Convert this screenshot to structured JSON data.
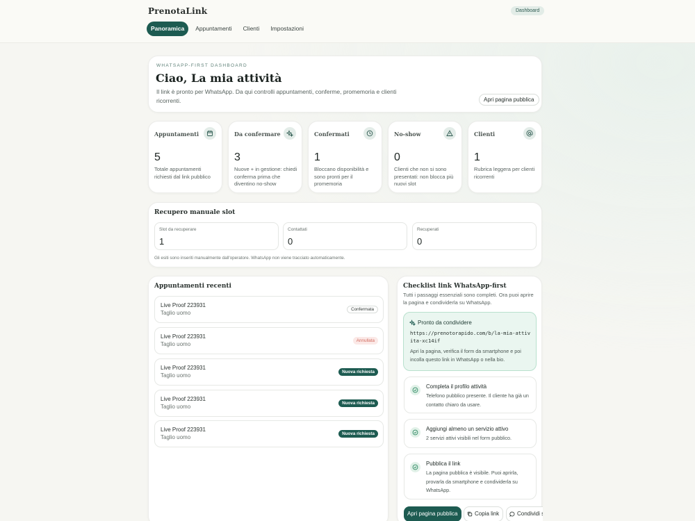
{
  "header": {
    "brand": "PrenotaLink",
    "badge": "Dashboard",
    "nav": [
      "Panoramica",
      "Appuntamenti",
      "Clienti",
      "Impostazioni"
    ]
  },
  "hero": {
    "eyebrow": "WHATSAPP-FIRST DASHBOARD",
    "title": "Ciao, La mia attività",
    "description": "Il link è pronto per WhatsApp. Da qui controlli appuntamenti, conferme, promemoria e clienti ricorrenti.",
    "button": "Apri pagina pubblica"
  },
  "stats": [
    {
      "label": "Appuntamenti",
      "value": "5",
      "desc": "Totale appuntamenti richiesti dal link pubblico",
      "icon": "calendar-icon"
    },
    {
      "label": "Da confermare",
      "value": "3",
      "desc": "Nuove + in gestione: chiedi conferma prima che diventino no-show",
      "icon": "sparkle-icon"
    },
    {
      "label": "Confermati",
      "value": "1",
      "desc": "Bloccano disponibilità e sono pronti per il promemoria",
      "icon": "clock-icon"
    },
    {
      "label": "No-show",
      "value": "0",
      "desc": "Clienti che non si sono presentati: non blocca più nuovi slot",
      "icon": "warning-icon"
    },
    {
      "label": "Clienti",
      "value": "1",
      "desc": "Rubrica leggera per clienti ricorrenti",
      "icon": "at-icon"
    }
  ],
  "recovery": {
    "title": "Recupero manuale slot",
    "boxes": [
      {
        "label": "Slot da recuperare",
        "value": "1"
      },
      {
        "label": "Contattati",
        "value": "0"
      },
      {
        "label": "Recuperati",
        "value": "0"
      }
    ],
    "note": "Gli esiti sono inseriti manualmente dall'operatore. WhatsApp non viene tracciato automaticamente."
  },
  "appointments": {
    "title": "Appuntamenti recenti",
    "items": [
      {
        "name": "Live Proof 223931",
        "service": "Taglio uomo",
        "status": "Confermata"
      },
      {
        "name": "Live Proof 223931",
        "service": "Taglio uomo",
        "status": "Annullata"
      },
      {
        "name": "Live Proof 223931",
        "service": "Taglio uomo",
        "status": "Nuova richiesta"
      },
      {
        "name": "Live Proof 223931",
        "service": "Taglio uomo",
        "status": "Nuova richiesta"
      },
      {
        "name": "Live Proof 223931",
        "service": "Taglio uomo",
        "status": "Nuova richiesta"
      }
    ]
  },
  "checklist": {
    "title": "Checklist link WhatsApp-first",
    "subtitle": "Tutti i passaggi essenziali sono completi. Ora puoi aprire la pagina e condividerla su WhatsApp.",
    "ready": {
      "title": "Pronto da condividere",
      "link": "https://prenotorapido.com/b/la-mia-attivita-xc14if",
      "desc": "Apri la pagina, verifica il form da smartphone e poi incolla questo link in WhatsApp o nella bio."
    },
    "steps": [
      {
        "title": "Completa il profilo attività",
        "desc": "Telefono pubblico presente. Il cliente ha già un contatto chiaro da usare."
      },
      {
        "title": "Aggiungi almeno un servizio attivo",
        "desc": "2 servizi attivi visibili nel form pubblico."
      },
      {
        "title": "Pubblica il link",
        "desc": "La pagina pubblica è visibile. Puoi aprirla, provarla da smartphone e condividerla su WhatsApp."
      }
    ],
    "actions": {
      "open": "Apri pagina pubblica",
      "copy": "Copia link",
      "share": "Condividi su WhatsApp"
    }
  },
  "colors": {
    "accent": "#1d5b51",
    "success_bg": "#eaf6f0",
    "danger": "#d26b5f"
  }
}
